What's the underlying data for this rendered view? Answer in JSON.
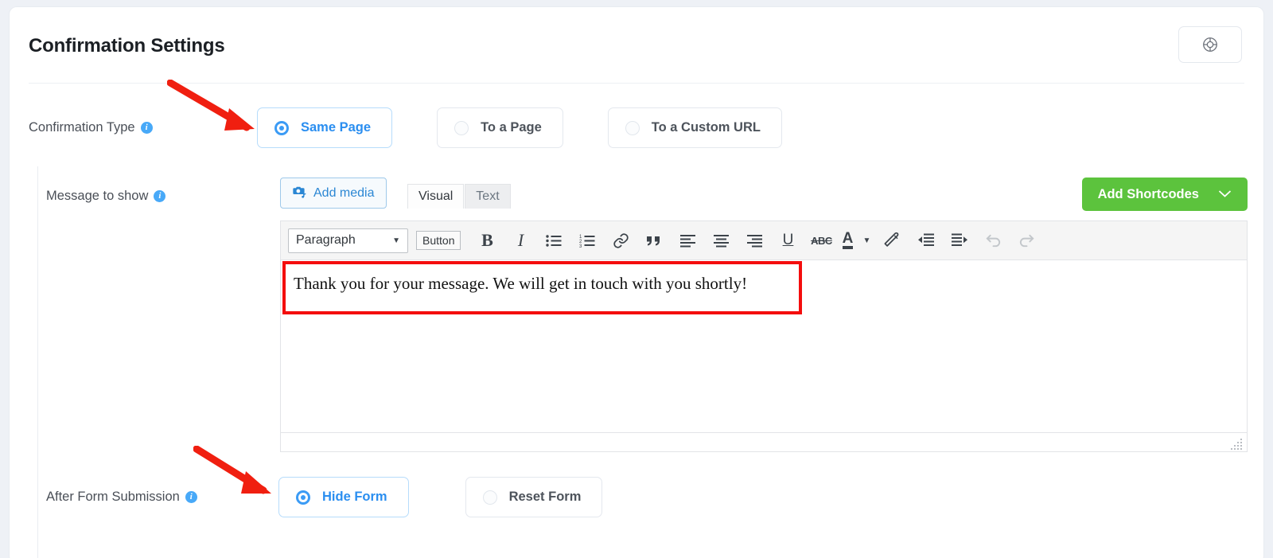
{
  "header": {
    "title": "Confirmation Settings",
    "help_icon": "lifebuoy-icon"
  },
  "confirmation_type": {
    "label": "Confirmation Type",
    "info_glyph": "i",
    "options": [
      {
        "label": "Same Page",
        "selected": true
      },
      {
        "label": "To a Page",
        "selected": false
      },
      {
        "label": "To a Custom URL",
        "selected": false
      }
    ]
  },
  "message_to_show": {
    "label": "Message to show",
    "info_glyph": "i",
    "add_media_label": "Add media",
    "add_media_icon": "media-camera-icon",
    "tabs": [
      {
        "label": "Visual",
        "active": true
      },
      {
        "label": "Text",
        "active": false
      }
    ],
    "shortcodes_label": "Add Shortcodes",
    "shortcodes_caret": "chevron-down-icon",
    "toolbar": {
      "format_select": "Paragraph",
      "button_label": "Button",
      "bold": "B",
      "italic": "I",
      "strikethrough": "ABC",
      "text_color": "A",
      "items": [
        "paragraph-format-select",
        "insert-button",
        "bold-icon",
        "italic-icon",
        "bulleted-list-icon",
        "numbered-list-icon",
        "link-icon",
        "blockquote-icon",
        "align-left-icon",
        "align-center-icon",
        "align-right-icon",
        "underline-icon",
        "strikethrough-icon",
        "text-color-icon",
        "text-color-caret-icon",
        "clear-formatting-icon",
        "outdent-icon",
        "indent-icon",
        "undo-icon",
        "redo-icon"
      ]
    },
    "content": "Thank you for your message. We will get in touch with you shortly!"
  },
  "after_form_submission": {
    "label": "After Form Submission",
    "info_glyph": "i",
    "options": [
      {
        "label": "Hide Form",
        "selected": true
      },
      {
        "label": "Reset Form",
        "selected": false
      }
    ]
  },
  "annotations": {
    "arrow_color": "#f01f10",
    "highlight_color": "#f40d0d"
  },
  "colors": {
    "accent_blue": "#2a8ef0",
    "radio_blue": "#3b9bf5",
    "green": "#5cc33d",
    "info_blue": "#48a9f8",
    "page_bg": "#eef1f6"
  }
}
